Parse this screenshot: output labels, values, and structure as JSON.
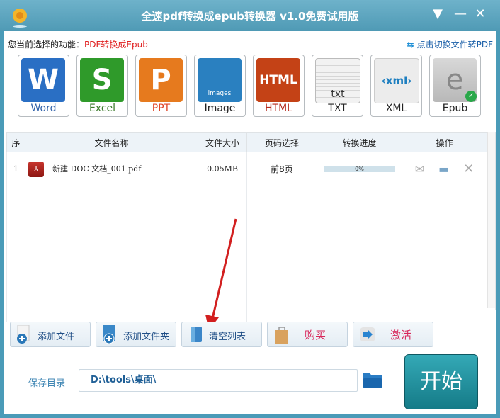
{
  "window": {
    "title": "全速pdf转换成epub转换器 v1.0免费试用版",
    "controls": {
      "menu": "▼",
      "minimize": "—",
      "close": "✕"
    }
  },
  "function_bar": {
    "label": "您当前选择的功能：",
    "value": "PDF转换成Epub",
    "switch_link": "点击切换文件转PDF",
    "switch_icon": "⇆"
  },
  "formats": [
    {
      "label": "Word",
      "glyph": "W",
      "color": "#2a6fc4",
      "text_color": "#2d5fa8"
    },
    {
      "label": "Excel",
      "glyph": "S",
      "color": "#2f9a2a",
      "text_color": "#3a7a2a"
    },
    {
      "label": "PPT",
      "glyph": "P",
      "color": "#e67a1e",
      "text_color": "#e0472a"
    },
    {
      "label": "Image",
      "glyph": "images",
      "color": "#2a80c0",
      "text_color": "#222222"
    },
    {
      "label": "HTML",
      "glyph": "HTML",
      "color": "#c44216",
      "text_color": "#b52a1c"
    },
    {
      "label": "TXT",
      "glyph": "txt",
      "color": "#e8e8e8",
      "text_color": "#222222"
    },
    {
      "label": "XML",
      "glyph": "‹xml›",
      "color": "#ececec",
      "text_color": "#222222"
    },
    {
      "label": "Epub",
      "glyph": "e",
      "color": "#c9c9c9",
      "text_color": "#222222",
      "selected": true
    }
  ],
  "table": {
    "headers": [
      "序",
      "文件名称",
      "文件大小",
      "页码选择",
      "转换进度",
      "操作"
    ],
    "rows": [
      {
        "index": "1",
        "name": "新建 DOC 文档_001.pdf",
        "size": "0.05MB",
        "pages": "前8页",
        "progress_text": "0%",
        "progress": 0
      }
    ]
  },
  "toolbar": {
    "add_file": "添加文件",
    "add_folder": "添加文件夹",
    "clear_list": "清空列表",
    "buy": "购买",
    "activate": "激活"
  },
  "output": {
    "label": "保存目录",
    "path": "D:\\tools\\桌面\\",
    "start": "开始"
  }
}
